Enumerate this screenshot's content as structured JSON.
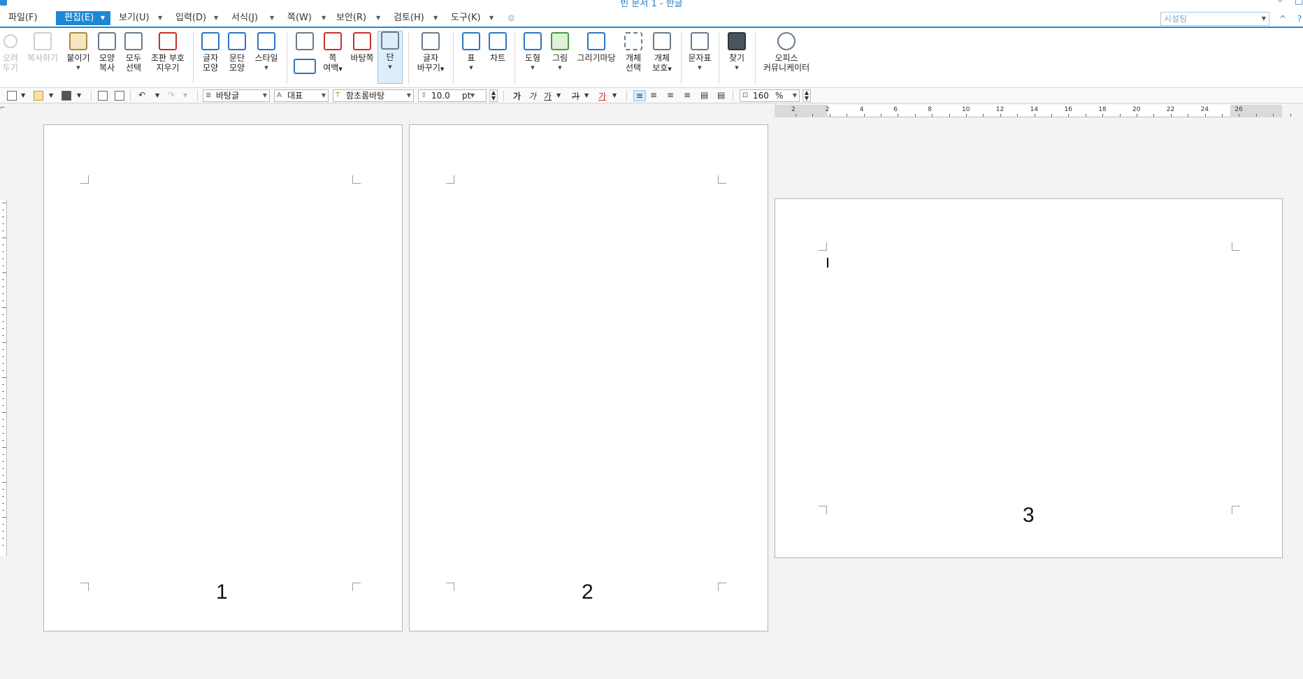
{
  "window": {
    "title": "빈 문서 1 - 한글",
    "minimize": "–",
    "restore": "□"
  },
  "menu": {
    "items": [
      "파일(F)",
      "편집(E)",
      "보기(U)",
      "입력(D)",
      "서식(J)",
      "쪽(W)",
      "보안(R)",
      "검토(H)",
      "도구(K)"
    ],
    "active": "편집(E)",
    "style_box": "시설팀",
    "collapse": "^",
    "help": "?"
  },
  "ribbon": {
    "cut": [
      "오려",
      "두기"
    ],
    "copy": "복사하기",
    "paste": "붙이기",
    "format_copy": [
      "모양",
      "복사"
    ],
    "select_all": [
      "모두",
      "선택"
    ],
    "remove_marks": [
      "조판 부호",
      "지우기"
    ],
    "char_shape": [
      "글자",
      "모양"
    ],
    "para_shape": [
      "문단",
      "모양"
    ],
    "style": "스타일",
    "page_margin": [
      "쪽",
      "여백"
    ],
    "master_page": "바탕쪽",
    "columns": "단",
    "replace": [
      "글자",
      "바꾸기"
    ],
    "table": "표",
    "chart": "차트",
    "shape": "도형",
    "picture": "그림",
    "draw_pad": "그리기마당",
    "object_select": [
      "개체",
      "선택"
    ],
    "object_protect": [
      "개체",
      "보호"
    ],
    "charmap": "문자표",
    "find": "찾기",
    "office_community": [
      "오피스",
      "커뮤니케이터"
    ]
  },
  "formatbar": {
    "style": "바탕글",
    "lang": "대표",
    "font": "함초롬바탕",
    "size": "10.0",
    "unit": "pt",
    "bold": "가",
    "italic": "가",
    "underline": "가",
    "strike": "가",
    "color": "가",
    "zoom": "160",
    "zoom_unit": "%"
  },
  "ruler": {
    "numbers": [
      "2",
      "2",
      "4",
      "6",
      "8",
      "10",
      "12",
      "14",
      "16",
      "18",
      "20",
      "22",
      "24",
      "26"
    ]
  },
  "pages": [
    {
      "number": "1"
    },
    {
      "number": "2"
    },
    {
      "number": "3"
    }
  ]
}
